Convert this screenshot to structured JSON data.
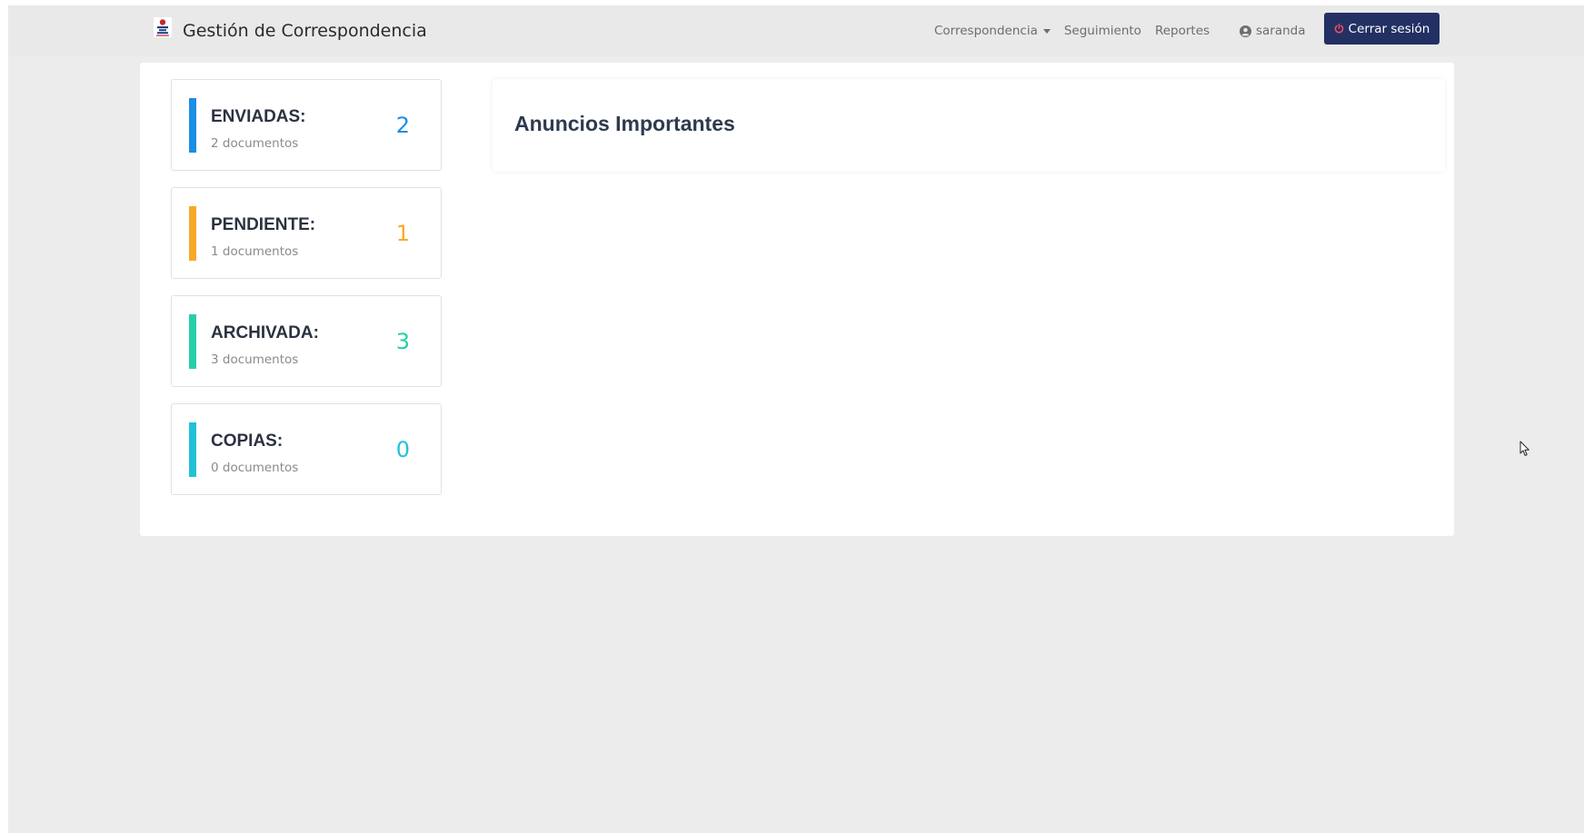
{
  "navbar": {
    "brand_title": "Gestión de Correspondencia",
    "links": [
      {
        "label": "Correspondencia",
        "has_dropdown": true
      },
      {
        "label": "Seguimiento"
      },
      {
        "label": "Reportes"
      }
    ],
    "user": {
      "icon": "user-circle-icon",
      "label": "saranda"
    },
    "logout": {
      "icon": "power-icon",
      "label": "Cerrar sesión",
      "color": "#233063"
    }
  },
  "stats": [
    {
      "title": "ENVIADAS:",
      "subtitle": "2 documentos",
      "count": "2",
      "color": "#1a8fe3"
    },
    {
      "title": "PENDIENTE:",
      "subtitle": "1 documentos",
      "count": "1",
      "color": "#f7a928"
    },
    {
      "title": "ARCHIVADA:",
      "subtitle": "3 documentos",
      "count": "3",
      "color": "#26cfa9"
    },
    {
      "title": "COPIAS:",
      "subtitle": "0 documentos",
      "count": "0",
      "color": "#22c1d8"
    }
  ],
  "announcements": {
    "title": "Anuncios Importantes"
  }
}
